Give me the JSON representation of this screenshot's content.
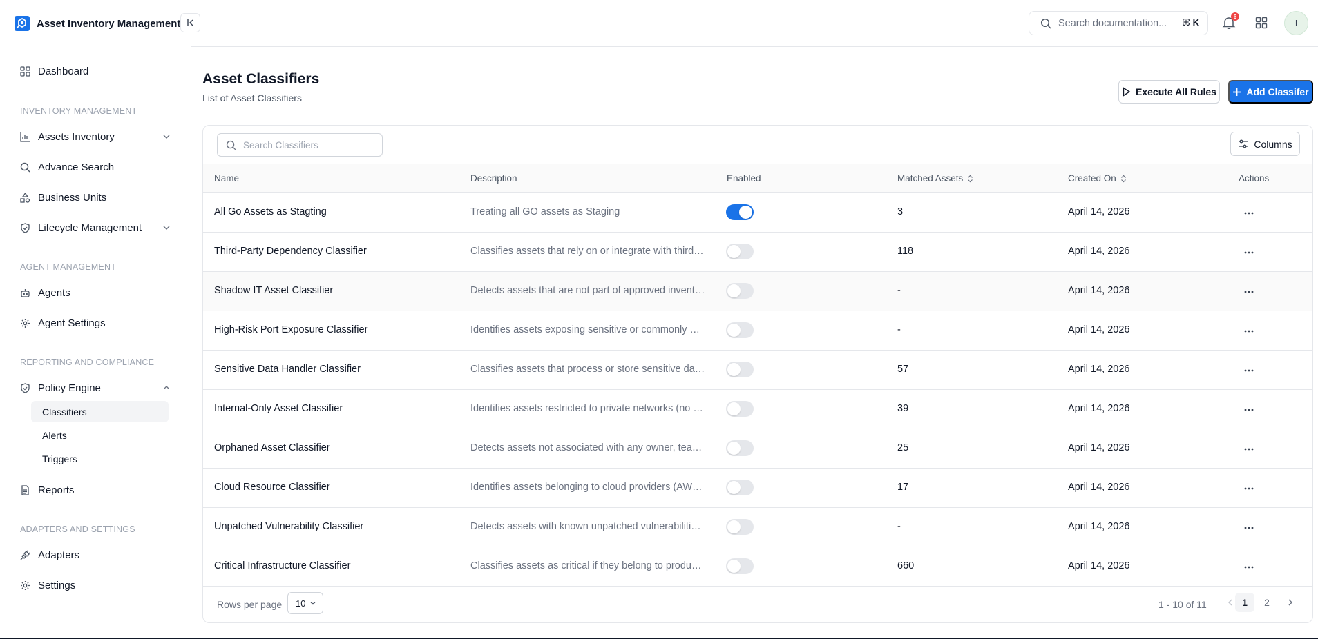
{
  "app": {
    "title": "Asset Inventory Management"
  },
  "sidebar": {
    "dashboard": "Dashboard",
    "sections": {
      "inventory": "INVENTORY MANAGEMENT",
      "agent": "AGENT MANAGEMENT",
      "reporting": "REPORTING AND COMPLIANCE",
      "adapters": "ADAPTERS AND SETTINGS"
    },
    "items": {
      "assets_inventory": "Assets Inventory",
      "advance_search": "Advance Search",
      "business_units": "Business Units",
      "lifecycle_management": "Lifecycle Management",
      "agents": "Agents",
      "agent_settings": "Agent Settings",
      "policy_engine": "Policy Engine",
      "reports": "Reports",
      "adapters": "Adapters",
      "settings": "Settings"
    },
    "policy_sub": {
      "classifiers": "Classifiers",
      "alerts": "Alerts",
      "triggers": "Triggers"
    }
  },
  "topbar": {
    "search_placeholder": "Search documentation...",
    "shortcut": "⌘ K",
    "notification_count": "6",
    "avatar_initial": "I"
  },
  "page": {
    "title": "Asset Classifiers",
    "subtitle": "List of Asset Classifiers",
    "execute_label": "Execute All Rules",
    "add_label": "Add Classifer"
  },
  "table": {
    "search_placeholder": "Search Classifiers",
    "columns_label": "Columns",
    "headers": {
      "name": "Name",
      "description": "Description",
      "enabled": "Enabled",
      "matched": "Matched Assets",
      "created": "Created On",
      "actions": "Actions"
    },
    "rows": [
      {
        "name": "All Go Assets as Stagting",
        "description": "Treating all GO assets as Staging",
        "enabled": true,
        "matched": "3",
        "created": "April 14, 2026"
      },
      {
        "name": "Third-Party Dependency Classifier",
        "description": "Classifies assets that rely on or integrate with third-p...",
        "enabled": false,
        "matched": "118",
        "created": "April 14, 2026"
      },
      {
        "name": "Shadow IT Asset Classifier",
        "description": "Detects assets that are not part of approved inventor...",
        "enabled": false,
        "matched": "-",
        "created": "April 14, 2026"
      },
      {
        "name": "High-Risk Port Exposure Classifier",
        "description": "Identifies assets exposing sensitive or commonly expl...",
        "enabled": false,
        "matched": "-",
        "created": "April 14, 2026"
      },
      {
        "name": "Sensitive Data Handler Classifier",
        "description": "Classifies assets that process or store sensitive data (...",
        "enabled": false,
        "matched": "57",
        "created": "April 14, 2026"
      },
      {
        "name": "Internal-Only Asset Classifier",
        "description": "Identifies assets restricted to private networks (no pu...",
        "enabled": false,
        "matched": "39",
        "created": "April 14, 2026"
      },
      {
        "name": "Orphaned Asset Classifier",
        "description": "Detects assets not associated with any owner, team, ...",
        "enabled": false,
        "matched": "25",
        "created": "April 14, 2026"
      },
      {
        "name": "Cloud Resource Classifier",
        "description": "Identifies assets belonging to cloud providers (AWS, ...",
        "enabled": false,
        "matched": "17",
        "created": "April 14, 2026"
      },
      {
        "name": "Unpatched Vulnerability Classifier",
        "description": "Detects assets with known unpatched vulnerabilities ...",
        "enabled": false,
        "matched": "-",
        "created": "April 14, 2026"
      },
      {
        "name": "Critical Infrastructure Classifier",
        "description": "Classifies assets as critical if they belong to productio...",
        "enabled": false,
        "matched": "660",
        "created": "April 14, 2026"
      }
    ]
  },
  "footer": {
    "rows_label": "Rows per page",
    "rows_value": "10",
    "range": "1 - 10 of 11",
    "pages": [
      "1",
      "2"
    ]
  },
  "colors": {
    "primary": "#1a73e8",
    "badge": "#ef4444",
    "border": "#e5e7eb"
  }
}
